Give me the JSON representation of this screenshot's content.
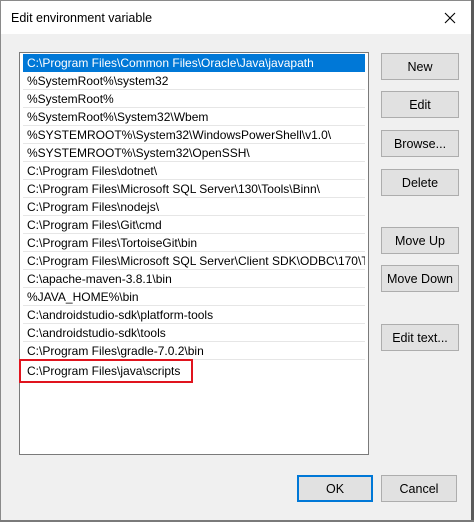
{
  "window": {
    "title": "Edit environment variable"
  },
  "list": {
    "items": [
      "C:\\Program Files\\Common Files\\Oracle\\Java\\javapath",
      "%SystemRoot%\\system32",
      "%SystemRoot%",
      "%SystemRoot%\\System32\\Wbem",
      "%SYSTEMROOT%\\System32\\WindowsPowerShell\\v1.0\\",
      "%SYSTEMROOT%\\System32\\OpenSSH\\",
      "C:\\Program Files\\dotnet\\",
      "C:\\Program Files\\Microsoft SQL Server\\130\\Tools\\Binn\\",
      "C:\\Program Files\\nodejs\\",
      "C:\\Program Files\\Git\\cmd",
      "C:\\Program Files\\TortoiseGit\\bin",
      "C:\\Program Files\\Microsoft SQL Server\\Client SDK\\ODBC\\170\\To...",
      "C:\\apache-maven-3.8.1\\bin",
      "%JAVA_HOME%\\bin",
      "C:\\androidstudio-sdk\\platform-tools",
      "C:\\androidstudio-sdk\\tools",
      "C:\\Program Files\\gradle-7.0.2\\bin",
      "C:\\Program Files\\java\\scripts"
    ]
  },
  "buttons": {
    "new": "New",
    "edit": "Edit",
    "browse": "Browse...",
    "delete": "Delete",
    "move_up": "Move Up",
    "move_down": "Move Down",
    "edit_text": "Edit text...",
    "ok": "OK",
    "cancel": "Cancel"
  },
  "colors": {
    "selection": "#0078d7",
    "highlight_border": "#e0141e",
    "default_button_border": "#0078d7"
  }
}
